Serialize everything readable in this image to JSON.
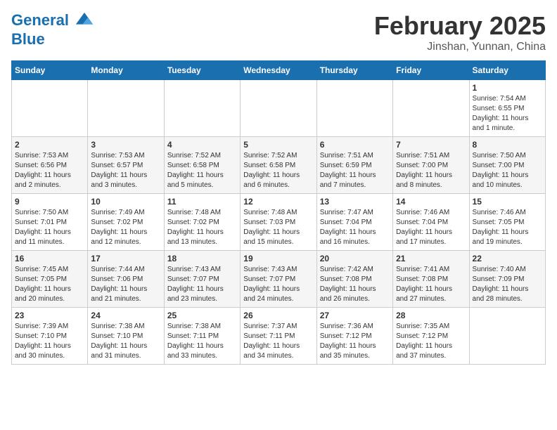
{
  "header": {
    "logo_line1": "General",
    "logo_line2": "Blue",
    "month": "February 2025",
    "location": "Jinshan, Yunnan, China"
  },
  "days_of_week": [
    "Sunday",
    "Monday",
    "Tuesday",
    "Wednesday",
    "Thursday",
    "Friday",
    "Saturday"
  ],
  "weeks": [
    [
      {
        "day": "",
        "info": ""
      },
      {
        "day": "",
        "info": ""
      },
      {
        "day": "",
        "info": ""
      },
      {
        "day": "",
        "info": ""
      },
      {
        "day": "",
        "info": ""
      },
      {
        "day": "",
        "info": ""
      },
      {
        "day": "1",
        "info": "Sunrise: 7:54 AM\nSunset: 6:55 PM\nDaylight: 11 hours\nand 1 minute."
      }
    ],
    [
      {
        "day": "2",
        "info": "Sunrise: 7:53 AM\nSunset: 6:56 PM\nDaylight: 11 hours\nand 2 minutes."
      },
      {
        "day": "3",
        "info": "Sunrise: 7:53 AM\nSunset: 6:57 PM\nDaylight: 11 hours\nand 3 minutes."
      },
      {
        "day": "4",
        "info": "Sunrise: 7:52 AM\nSunset: 6:58 PM\nDaylight: 11 hours\nand 5 minutes."
      },
      {
        "day": "5",
        "info": "Sunrise: 7:52 AM\nSunset: 6:58 PM\nDaylight: 11 hours\nand 6 minutes."
      },
      {
        "day": "6",
        "info": "Sunrise: 7:51 AM\nSunset: 6:59 PM\nDaylight: 11 hours\nand 7 minutes."
      },
      {
        "day": "7",
        "info": "Sunrise: 7:51 AM\nSunset: 7:00 PM\nDaylight: 11 hours\nand 8 minutes."
      },
      {
        "day": "8",
        "info": "Sunrise: 7:50 AM\nSunset: 7:00 PM\nDaylight: 11 hours\nand 10 minutes."
      }
    ],
    [
      {
        "day": "9",
        "info": "Sunrise: 7:50 AM\nSunset: 7:01 PM\nDaylight: 11 hours\nand 11 minutes."
      },
      {
        "day": "10",
        "info": "Sunrise: 7:49 AM\nSunset: 7:02 PM\nDaylight: 11 hours\nand 12 minutes."
      },
      {
        "day": "11",
        "info": "Sunrise: 7:48 AM\nSunset: 7:02 PM\nDaylight: 11 hours\nand 13 minutes."
      },
      {
        "day": "12",
        "info": "Sunrise: 7:48 AM\nSunset: 7:03 PM\nDaylight: 11 hours\nand 15 minutes."
      },
      {
        "day": "13",
        "info": "Sunrise: 7:47 AM\nSunset: 7:04 PM\nDaylight: 11 hours\nand 16 minutes."
      },
      {
        "day": "14",
        "info": "Sunrise: 7:46 AM\nSunset: 7:04 PM\nDaylight: 11 hours\nand 17 minutes."
      },
      {
        "day": "15",
        "info": "Sunrise: 7:46 AM\nSunset: 7:05 PM\nDaylight: 11 hours\nand 19 minutes."
      }
    ],
    [
      {
        "day": "16",
        "info": "Sunrise: 7:45 AM\nSunset: 7:05 PM\nDaylight: 11 hours\nand 20 minutes."
      },
      {
        "day": "17",
        "info": "Sunrise: 7:44 AM\nSunset: 7:06 PM\nDaylight: 11 hours\nand 21 minutes."
      },
      {
        "day": "18",
        "info": "Sunrise: 7:43 AM\nSunset: 7:07 PM\nDaylight: 11 hours\nand 23 minutes."
      },
      {
        "day": "19",
        "info": "Sunrise: 7:43 AM\nSunset: 7:07 PM\nDaylight: 11 hours\nand 24 minutes."
      },
      {
        "day": "20",
        "info": "Sunrise: 7:42 AM\nSunset: 7:08 PM\nDaylight: 11 hours\nand 26 minutes."
      },
      {
        "day": "21",
        "info": "Sunrise: 7:41 AM\nSunset: 7:08 PM\nDaylight: 11 hours\nand 27 minutes."
      },
      {
        "day": "22",
        "info": "Sunrise: 7:40 AM\nSunset: 7:09 PM\nDaylight: 11 hours\nand 28 minutes."
      }
    ],
    [
      {
        "day": "23",
        "info": "Sunrise: 7:39 AM\nSunset: 7:10 PM\nDaylight: 11 hours\nand 30 minutes."
      },
      {
        "day": "24",
        "info": "Sunrise: 7:38 AM\nSunset: 7:10 PM\nDaylight: 11 hours\nand 31 minutes."
      },
      {
        "day": "25",
        "info": "Sunrise: 7:38 AM\nSunset: 7:11 PM\nDaylight: 11 hours\nand 33 minutes."
      },
      {
        "day": "26",
        "info": "Sunrise: 7:37 AM\nSunset: 7:11 PM\nDaylight: 11 hours\nand 34 minutes."
      },
      {
        "day": "27",
        "info": "Sunrise: 7:36 AM\nSunset: 7:12 PM\nDaylight: 11 hours\nand 35 minutes."
      },
      {
        "day": "28",
        "info": "Sunrise: 7:35 AM\nSunset: 7:12 PM\nDaylight: 11 hours\nand 37 minutes."
      },
      {
        "day": "",
        "info": ""
      }
    ]
  ]
}
